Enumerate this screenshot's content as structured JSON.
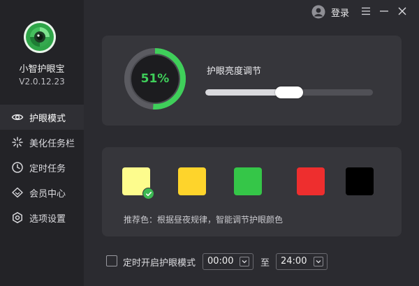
{
  "app": {
    "name": "小智护眼宝",
    "version": "V2.0.12.23"
  },
  "header": {
    "login_label": "登录"
  },
  "sidebar": {
    "items": [
      {
        "label": "护眼模式",
        "icon": "eye-icon",
        "active": true
      },
      {
        "label": "美化任务栏",
        "icon": "sparkle-icon",
        "active": false
      },
      {
        "label": "定时任务",
        "icon": "clock-icon",
        "active": false
      },
      {
        "label": "会员中心",
        "icon": "diamond-icon",
        "active": false
      },
      {
        "label": "选项设置",
        "icon": "settings-icon",
        "active": false
      }
    ]
  },
  "brightness": {
    "label": "护眼亮度调节",
    "value_text": "51%",
    "value": 0.51,
    "slider_value": 0.5
  },
  "colors": {
    "swatches": [
      {
        "color": "#fdfc8d",
        "selected": true
      },
      {
        "color": "#fed42b",
        "selected": false
      },
      {
        "color": "#35c648",
        "selected": false
      },
      {
        "color": "#ee2e2e",
        "selected": false
      },
      {
        "color": "#000000",
        "selected": false
      }
    ],
    "hint": "推荐色：根据昼夜规律，智能调节护眼颜色"
  },
  "schedule": {
    "label": "定时开启护眼模式",
    "checked": false,
    "start": "00:00",
    "to_label": "至",
    "end": "24:00"
  },
  "theme": {
    "accent": "#3fcf5a",
    "sidebar_bg": "#232327",
    "main_bg": "#2b2b30",
    "panel_bg": "#36363b"
  }
}
